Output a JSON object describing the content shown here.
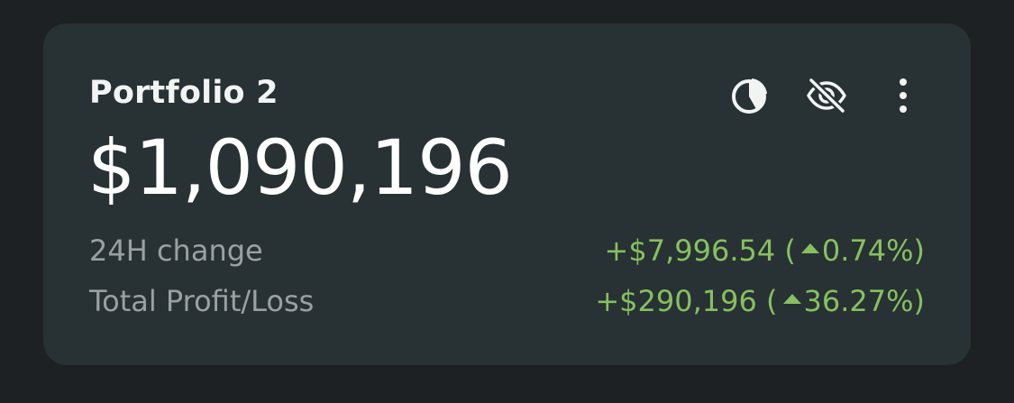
{
  "card": {
    "title": "Portfolio 2",
    "total_value": "$1,090,196",
    "rows": [
      {
        "label": "24H change",
        "amount": "+$7,996.54",
        "percent": "0.74%",
        "direction": "up"
      },
      {
        "label": "Total Profit/Loss",
        "amount": "+$290,196",
        "percent": "36.27%",
        "direction": "up"
      }
    ],
    "actions": [
      {
        "icon": "pie-chart-icon"
      },
      {
        "icon": "eye-off-icon"
      },
      {
        "icon": "more-vertical-icon"
      }
    ]
  },
  "colors": {
    "background": "#1d2123",
    "card": "#283133",
    "positive": "#86c060",
    "label": "#9aa1a3",
    "text": "#ffffff"
  }
}
